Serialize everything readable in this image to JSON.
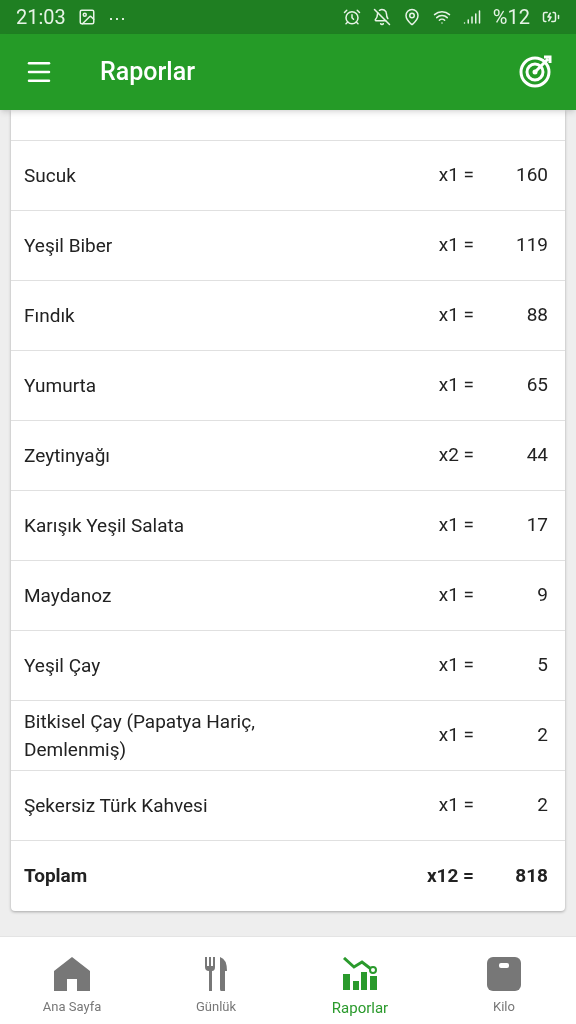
{
  "status_bar": {
    "time": "21:03",
    "more": "⋯",
    "battery": "%12"
  },
  "app_bar": {
    "title": "Raporlar"
  },
  "table": {
    "rows": [
      {
        "name": "Sucuk",
        "qty": "x1 =",
        "value": "160"
      },
      {
        "name": "Yeşil Biber",
        "qty": "x1 =",
        "value": "119"
      },
      {
        "name": "Fındık",
        "qty": "x1 =",
        "value": "88"
      },
      {
        "name": "Yumurta",
        "qty": "x1 =",
        "value": "65"
      },
      {
        "name": "Zeytinyağı",
        "qty": "x2 =",
        "value": "44"
      },
      {
        "name": "Karışık Yeşil Salata",
        "qty": "x1 =",
        "value": "17"
      },
      {
        "name": "Maydanoz",
        "qty": "x1 =",
        "value": "9"
      },
      {
        "name": "Yeşil Çay",
        "qty": "x1 =",
        "value": "5"
      },
      {
        "name": "Bitkisel Çay (Papatya Hariç, Demlenmiş)",
        "qty": "x1 =",
        "value": "2"
      },
      {
        "name": "Şekersiz Türk Kahvesi",
        "qty": "x1 =",
        "value": "2"
      }
    ],
    "total": {
      "name": "Toplam",
      "qty": "x12 =",
      "value": "818"
    }
  },
  "bottom_nav": [
    {
      "kind": "home",
      "label": "Ana Sayfa",
      "selected": false
    },
    {
      "kind": "diary",
      "label": "Günlük",
      "selected": false
    },
    {
      "kind": "reports",
      "label": "Raporlar",
      "selected": true
    },
    {
      "kind": "scale",
      "label": "Kilo",
      "selected": false
    }
  ]
}
